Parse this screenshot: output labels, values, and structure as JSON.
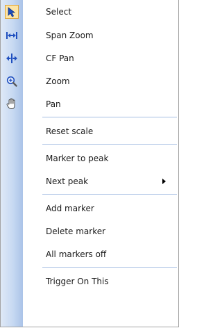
{
  "menu": {
    "items": [
      {
        "label": "Select",
        "icon": "cursor-arrow-icon",
        "checked": true
      },
      {
        "label": "Span Zoom",
        "icon": "span-zoom-icon"
      },
      {
        "label": "CF Pan",
        "icon": "cf-pan-icon"
      },
      {
        "label": "Zoom",
        "icon": "zoom-icon"
      },
      {
        "label": "Pan",
        "icon": "hand-pan-icon"
      },
      {
        "label": "Reset scale"
      },
      {
        "label": "Marker to peak"
      },
      {
        "label": "Next peak",
        "submenu": true
      },
      {
        "label": "Add marker"
      },
      {
        "label": "Delete marker"
      },
      {
        "label": "All markers off"
      },
      {
        "label": "Trigger On This"
      }
    ]
  },
  "colors": {
    "gutter": "#c7d9f2",
    "separator": "#a4bde3",
    "icon_blue": "#1f4fbf",
    "checked_bg": "#fde5a6"
  }
}
